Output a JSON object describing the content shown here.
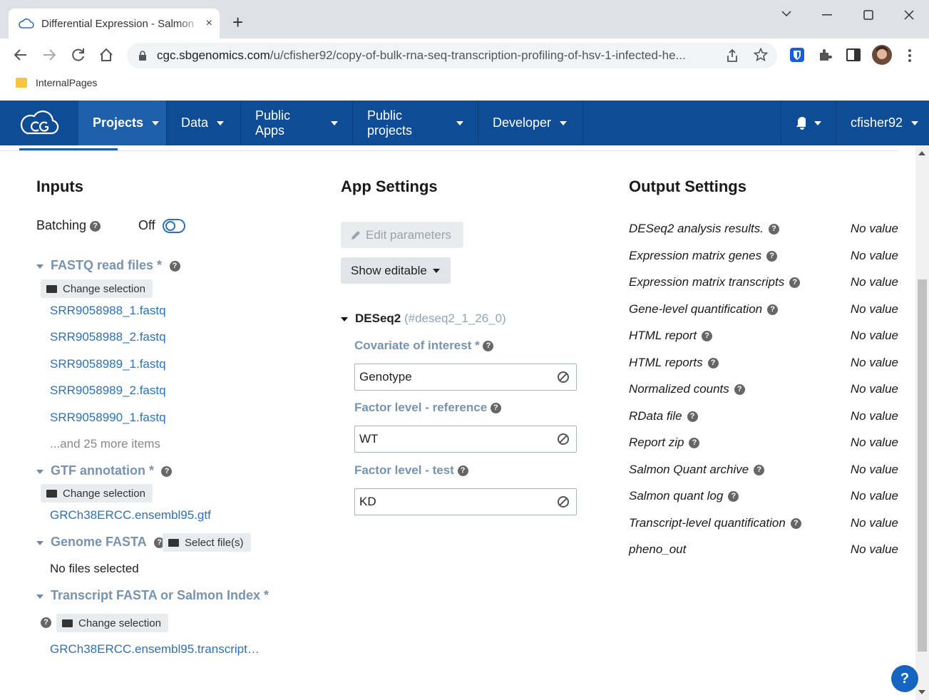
{
  "browser": {
    "tab_title": "Differential Expression - Salmon",
    "url_host": "cgc.sbgenomics.com",
    "url_path": "/u/cfisher92/copy-of-bulk-rna-seq-transcription-profiling-of-hsv-1-infected-he...",
    "bookmark": "InternalPages",
    "new_tab": "+",
    "tab_close": "×"
  },
  "nav": {
    "items": [
      "Projects",
      "Data",
      "Public Apps",
      "Public projects",
      "Developer"
    ],
    "user": "cfisher92"
  },
  "inputs": {
    "heading": "Inputs",
    "batching_label": "Batching",
    "batching_state": "Off",
    "fastq": {
      "label": "FASTQ read files *",
      "button": "Change selection",
      "files": [
        "SRR9058988_1.fastq",
        "SRR9058988_2.fastq",
        "SRR9058989_1.fastq",
        "SRR9058989_2.fastq",
        "SRR9058990_1.fastq"
      ],
      "more": "...and 25 more items"
    },
    "gtf": {
      "label": "GTF annotation *",
      "button": "Change selection",
      "file": "GRCh38ERCC.ensembl95.gtf"
    },
    "genome": {
      "label": "Genome FASTA",
      "button": "Select file(s)",
      "empty": "No files selected"
    },
    "transcript": {
      "label": "Transcript FASTA or Salmon Index *",
      "button": "Change selection",
      "file": "GRCh38ERCC.ensembl95.transcript…"
    }
  },
  "app_settings": {
    "heading": "App Settings",
    "edit_button": "Edit parameters",
    "show_button": "Show editable",
    "node_name": "DESeq2",
    "node_id": "(#deseq2_1_26_0)",
    "params": [
      {
        "label": "Covariate of interest *",
        "value": "Genotype"
      },
      {
        "label": "Factor level - reference",
        "value": "WT"
      },
      {
        "label": "Factor level - test",
        "value": "KD"
      }
    ]
  },
  "output_settings": {
    "heading": "Output Settings",
    "rows": [
      {
        "name": "DESeq2 analysis results.",
        "value": "No value"
      },
      {
        "name": "Expression matrix genes",
        "value": "No value"
      },
      {
        "name": "Expression matrix transcripts",
        "value": "No value"
      },
      {
        "name": "Gene-level quantification",
        "value": "No value"
      },
      {
        "name": "HTML report",
        "value": "No value"
      },
      {
        "name": "HTML reports",
        "value": "No value"
      },
      {
        "name": "Normalized counts",
        "value": "No value"
      },
      {
        "name": "RData file",
        "value": "No value"
      },
      {
        "name": "Report zip",
        "value": "No value"
      },
      {
        "name": "Salmon Quant archive",
        "value": "No value"
      },
      {
        "name": "Salmon quant log",
        "value": "No value"
      },
      {
        "name": "Transcript-level quantification",
        "value": "No value"
      },
      {
        "name": "pheno_out",
        "value": "No value"
      }
    ]
  },
  "help_fab": "?",
  "colors": {
    "nav_bg": "#0e4c95",
    "nav_active": "#1d5fa8",
    "link": "#2d72b8",
    "section_label": "#7793b0"
  }
}
